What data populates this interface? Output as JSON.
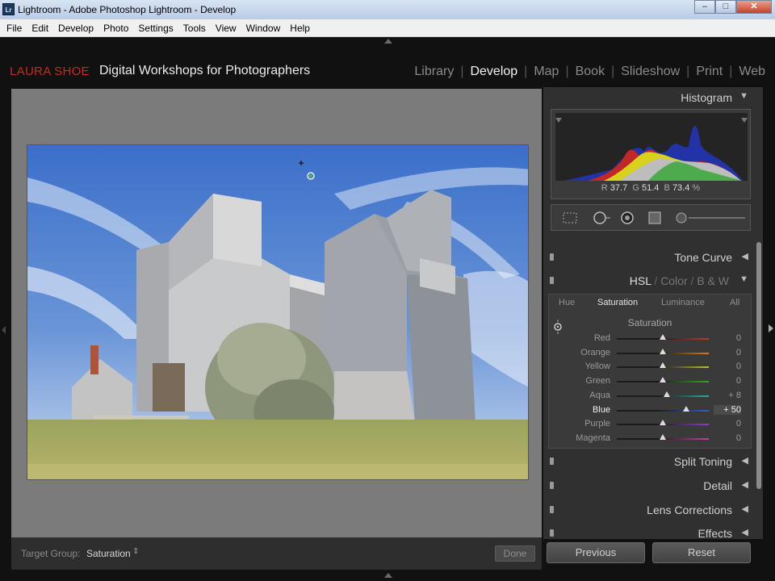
{
  "window": {
    "title": "Lightroom - Adobe Photoshop Lightroom - Develop",
    "app_icon": "Lr"
  },
  "menu": [
    "File",
    "Edit",
    "Develop",
    "Photo",
    "Settings",
    "Tools",
    "View",
    "Window",
    "Help"
  ],
  "identity": {
    "name": "LAURA SHOE",
    "tagline": "Digital Workshops for Photographers"
  },
  "modules": [
    {
      "label": "Library",
      "active": false
    },
    {
      "label": "Develop",
      "active": true
    },
    {
      "label": "Map",
      "active": false
    },
    {
      "label": "Book",
      "active": false
    },
    {
      "label": "Slideshow",
      "active": false
    },
    {
      "label": "Print",
      "active": false
    },
    {
      "label": "Web",
      "active": false
    }
  ],
  "histogram": {
    "title": "Histogram",
    "readout": {
      "r_label": "R",
      "r": "37.7",
      "g_label": "G",
      "g": "51.4",
      "b_label": "B",
      "b": "73.4",
      "unit": "%"
    }
  },
  "panels": {
    "tone_curve": "Tone Curve",
    "hsl_group": {
      "hsl": "HSL",
      "slash1": "/",
      "color": "Color",
      "slash2": "/",
      "bw": "B & W"
    },
    "split_toning": "Split Toning",
    "detail": "Detail",
    "lens_corrections": "Lens Corrections",
    "effects": "Effects"
  },
  "hsl": {
    "tabs": [
      "Hue",
      "Saturation",
      "Luminance",
      "All"
    ],
    "selected_tab": "Saturation",
    "section_title": "Saturation",
    "sliders": [
      {
        "label": "Red",
        "value": "0",
        "level": 0,
        "color": "#c0392b"
      },
      {
        "label": "Orange",
        "value": "0",
        "level": 0,
        "color": "#d67d23"
      },
      {
        "label": "Yellow",
        "value": "0",
        "level": 0,
        "color": "#c9b92a"
      },
      {
        "label": "Green",
        "value": "0",
        "level": 0,
        "color": "#3f9c35"
      },
      {
        "label": "Aqua",
        "value": "+ 8",
        "level": 8,
        "color": "#2fa6a0"
      },
      {
        "label": "Blue",
        "value": "+ 50",
        "level": 50,
        "color": "#2f5fd0"
      },
      {
        "label": "Purple",
        "value": "0",
        "level": 0,
        "color": "#8b3fc4"
      },
      {
        "label": "Magenta",
        "value": "0",
        "level": 0,
        "color": "#c43fa5"
      }
    ]
  },
  "toolbar": {
    "target_group_label": "Target Group:",
    "target_group_value": "Saturation",
    "done": "Done"
  },
  "buttons": {
    "previous": "Previous",
    "reset": "Reset"
  }
}
